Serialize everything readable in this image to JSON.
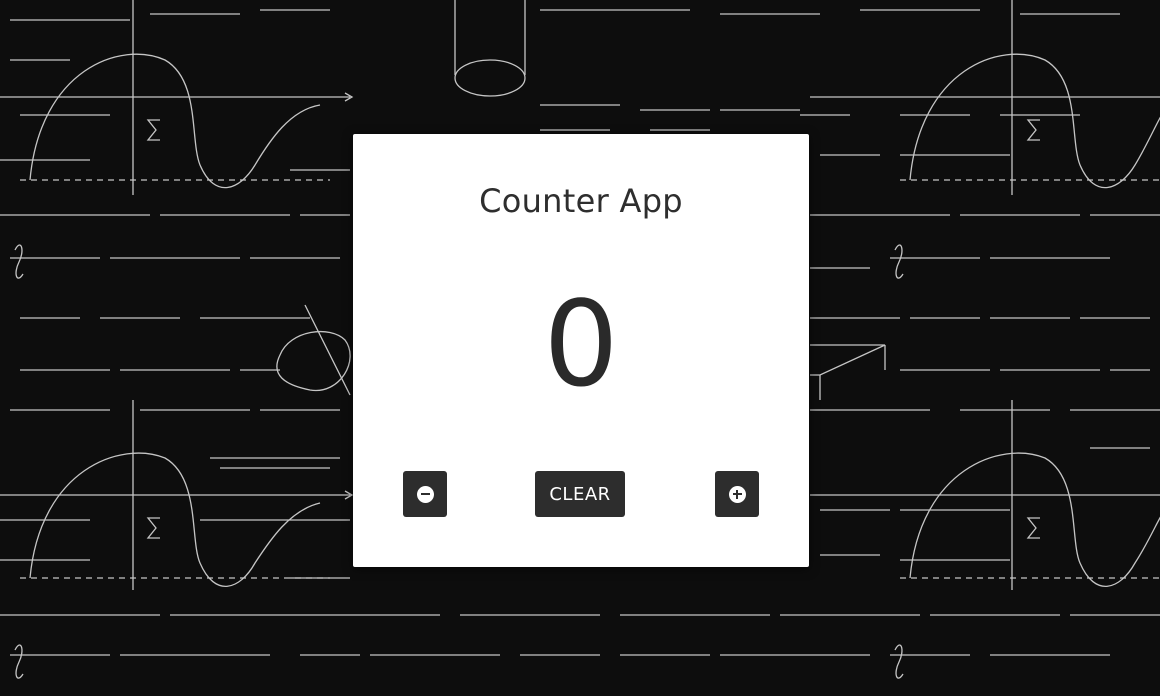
{
  "app": {
    "title": "Counter App",
    "count": "0"
  },
  "controls": {
    "decrement_icon": "minus-circle-icon",
    "clear_label": "CLEAR",
    "increment_icon": "plus-circle-icon"
  },
  "colors": {
    "background": "#0d0d0d",
    "card": "#ffffff",
    "button": "#2d2d2d",
    "text": "#2e2e2e"
  }
}
